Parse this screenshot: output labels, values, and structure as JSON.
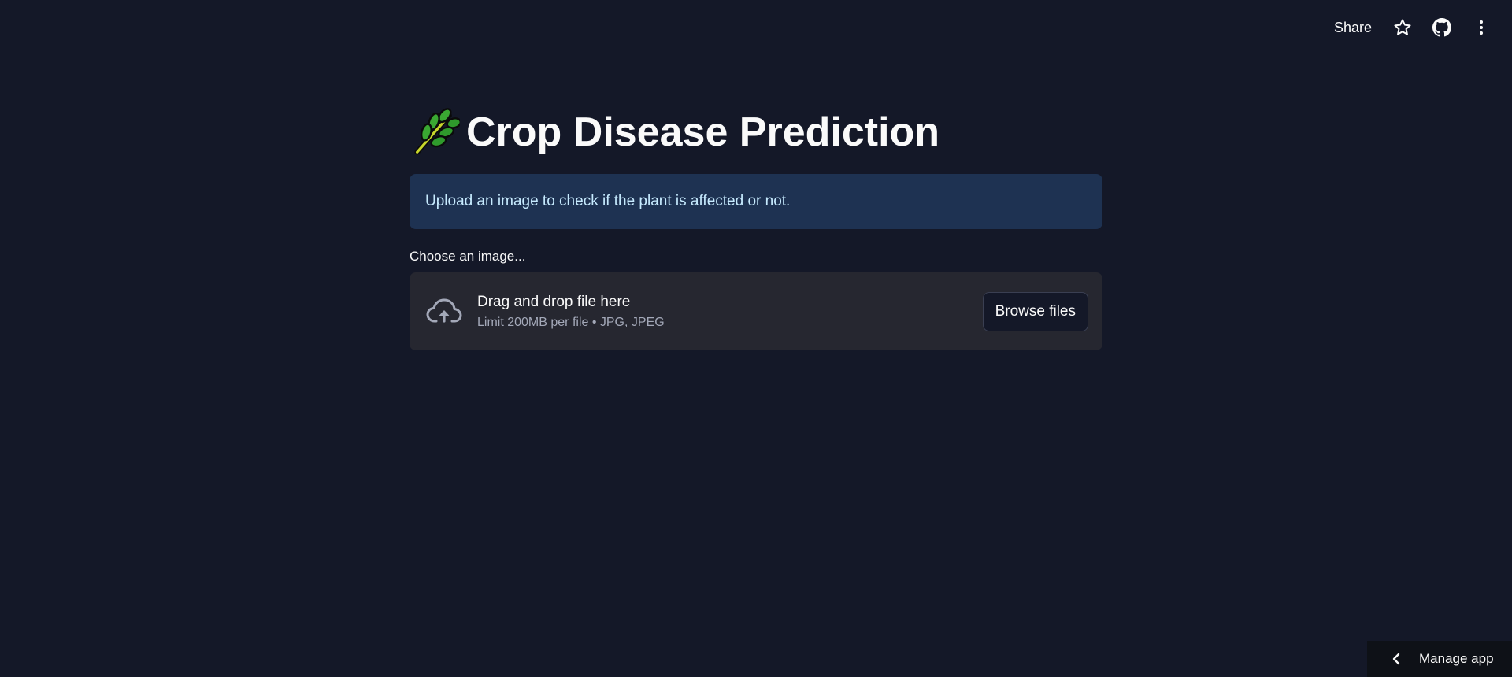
{
  "toolbar": {
    "share_label": "Share",
    "icons": [
      "star-icon",
      "github-icon",
      "more-vertical-icon"
    ]
  },
  "main": {
    "title": "Crop Disease Prediction",
    "title_icon": "herb-icon",
    "info_message": "Upload an image to check if the plant is affected or not.",
    "uploader": {
      "label": "Choose an image...",
      "drop_title": "Drag and drop file here",
      "drop_subtitle": "Limit 200MB per file • JPG, JPEG",
      "browse_label": "Browse files",
      "icon": "cloud-upload-icon"
    }
  },
  "footer": {
    "manage_app_label": "Manage app",
    "icon": "chevron-left-icon"
  },
  "colors": {
    "background": "#141828",
    "info_bg": "#1e3252",
    "info_text": "#c7ebff",
    "dropzone_bg": "#262730"
  }
}
